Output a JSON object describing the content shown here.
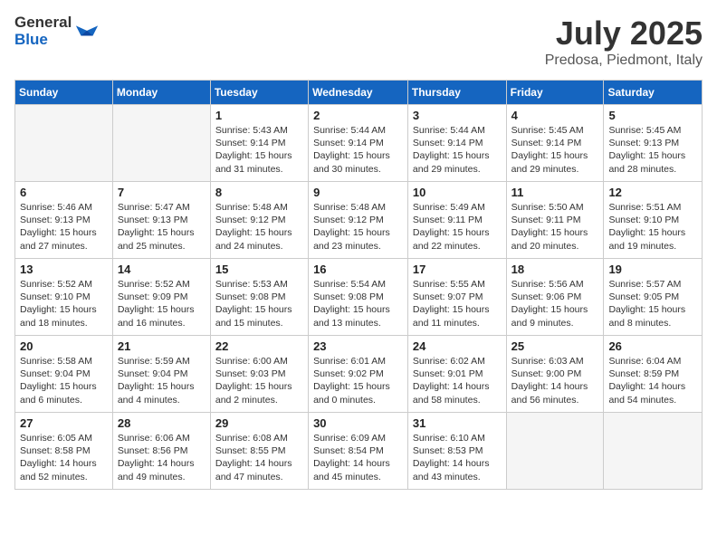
{
  "logo": {
    "general": "General",
    "blue": "Blue"
  },
  "title": {
    "month_year": "July 2025",
    "location": "Predosa, Piedmont, Italy"
  },
  "days_of_week": [
    "Sunday",
    "Monday",
    "Tuesday",
    "Wednesday",
    "Thursday",
    "Friday",
    "Saturday"
  ],
  "weeks": [
    [
      {
        "num": "",
        "info": ""
      },
      {
        "num": "",
        "info": ""
      },
      {
        "num": "1",
        "info": "Sunrise: 5:43 AM\nSunset: 9:14 PM\nDaylight: 15 hours\nand 31 minutes."
      },
      {
        "num": "2",
        "info": "Sunrise: 5:44 AM\nSunset: 9:14 PM\nDaylight: 15 hours\nand 30 minutes."
      },
      {
        "num": "3",
        "info": "Sunrise: 5:44 AM\nSunset: 9:14 PM\nDaylight: 15 hours\nand 29 minutes."
      },
      {
        "num": "4",
        "info": "Sunrise: 5:45 AM\nSunset: 9:14 PM\nDaylight: 15 hours\nand 29 minutes."
      },
      {
        "num": "5",
        "info": "Sunrise: 5:45 AM\nSunset: 9:13 PM\nDaylight: 15 hours\nand 28 minutes."
      }
    ],
    [
      {
        "num": "6",
        "info": "Sunrise: 5:46 AM\nSunset: 9:13 PM\nDaylight: 15 hours\nand 27 minutes."
      },
      {
        "num": "7",
        "info": "Sunrise: 5:47 AM\nSunset: 9:13 PM\nDaylight: 15 hours\nand 25 minutes."
      },
      {
        "num": "8",
        "info": "Sunrise: 5:48 AM\nSunset: 9:12 PM\nDaylight: 15 hours\nand 24 minutes."
      },
      {
        "num": "9",
        "info": "Sunrise: 5:48 AM\nSunset: 9:12 PM\nDaylight: 15 hours\nand 23 minutes."
      },
      {
        "num": "10",
        "info": "Sunrise: 5:49 AM\nSunset: 9:11 PM\nDaylight: 15 hours\nand 22 minutes."
      },
      {
        "num": "11",
        "info": "Sunrise: 5:50 AM\nSunset: 9:11 PM\nDaylight: 15 hours\nand 20 minutes."
      },
      {
        "num": "12",
        "info": "Sunrise: 5:51 AM\nSunset: 9:10 PM\nDaylight: 15 hours\nand 19 minutes."
      }
    ],
    [
      {
        "num": "13",
        "info": "Sunrise: 5:52 AM\nSunset: 9:10 PM\nDaylight: 15 hours\nand 18 minutes."
      },
      {
        "num": "14",
        "info": "Sunrise: 5:52 AM\nSunset: 9:09 PM\nDaylight: 15 hours\nand 16 minutes."
      },
      {
        "num": "15",
        "info": "Sunrise: 5:53 AM\nSunset: 9:08 PM\nDaylight: 15 hours\nand 15 minutes."
      },
      {
        "num": "16",
        "info": "Sunrise: 5:54 AM\nSunset: 9:08 PM\nDaylight: 15 hours\nand 13 minutes."
      },
      {
        "num": "17",
        "info": "Sunrise: 5:55 AM\nSunset: 9:07 PM\nDaylight: 15 hours\nand 11 minutes."
      },
      {
        "num": "18",
        "info": "Sunrise: 5:56 AM\nSunset: 9:06 PM\nDaylight: 15 hours\nand 9 minutes."
      },
      {
        "num": "19",
        "info": "Sunrise: 5:57 AM\nSunset: 9:05 PM\nDaylight: 15 hours\nand 8 minutes."
      }
    ],
    [
      {
        "num": "20",
        "info": "Sunrise: 5:58 AM\nSunset: 9:04 PM\nDaylight: 15 hours\nand 6 minutes."
      },
      {
        "num": "21",
        "info": "Sunrise: 5:59 AM\nSunset: 9:04 PM\nDaylight: 15 hours\nand 4 minutes."
      },
      {
        "num": "22",
        "info": "Sunrise: 6:00 AM\nSunset: 9:03 PM\nDaylight: 15 hours\nand 2 minutes."
      },
      {
        "num": "23",
        "info": "Sunrise: 6:01 AM\nSunset: 9:02 PM\nDaylight: 15 hours\nand 0 minutes."
      },
      {
        "num": "24",
        "info": "Sunrise: 6:02 AM\nSunset: 9:01 PM\nDaylight: 14 hours\nand 58 minutes."
      },
      {
        "num": "25",
        "info": "Sunrise: 6:03 AM\nSunset: 9:00 PM\nDaylight: 14 hours\nand 56 minutes."
      },
      {
        "num": "26",
        "info": "Sunrise: 6:04 AM\nSunset: 8:59 PM\nDaylight: 14 hours\nand 54 minutes."
      }
    ],
    [
      {
        "num": "27",
        "info": "Sunrise: 6:05 AM\nSunset: 8:58 PM\nDaylight: 14 hours\nand 52 minutes."
      },
      {
        "num": "28",
        "info": "Sunrise: 6:06 AM\nSunset: 8:56 PM\nDaylight: 14 hours\nand 49 minutes."
      },
      {
        "num": "29",
        "info": "Sunrise: 6:08 AM\nSunset: 8:55 PM\nDaylight: 14 hours\nand 47 minutes."
      },
      {
        "num": "30",
        "info": "Sunrise: 6:09 AM\nSunset: 8:54 PM\nDaylight: 14 hours\nand 45 minutes."
      },
      {
        "num": "31",
        "info": "Sunrise: 6:10 AM\nSunset: 8:53 PM\nDaylight: 14 hours\nand 43 minutes."
      },
      {
        "num": "",
        "info": ""
      },
      {
        "num": "",
        "info": ""
      }
    ]
  ]
}
